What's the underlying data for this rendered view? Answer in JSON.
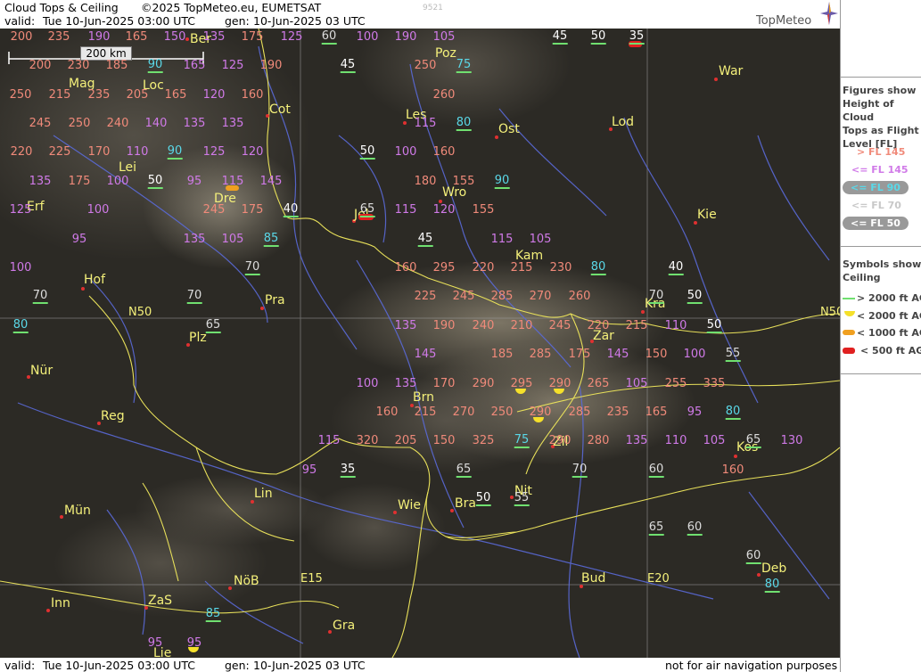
{
  "header": {
    "product": "Cloud Tops & Ceiling",
    "copyright": "©2025 TopMeteo.eu, EUMETSAT",
    "valid_label": "valid:",
    "valid_value": "Tue   10-Jun-2025  03:00 UTC",
    "gen_label": "gen:",
    "gen_value": "10-Jun-2025 03 UTC",
    "run_code": "9521",
    "logo": "TopMeteo"
  },
  "footer": {
    "valid_label": "valid:",
    "valid_value": "Tue   10-Jun-2025  03:00 UTC",
    "gen_label": "gen:",
    "gen_value": "10-Jun-2025 03 UTC",
    "disclaimer": "not for air navigation purposes"
  },
  "scale": {
    "label": "200 km"
  },
  "legend": {
    "heights_title": [
      "Figures show",
      "Height of Cloud",
      "Tops as Flight",
      "Level  [FL]"
    ],
    "height_classes": [
      {
        "label": "> FL 145",
        "color": "#f08a7a"
      },
      {
        "label": "<= FL 145",
        "color": "#d07ae8"
      },
      {
        "label": "<= FL 90",
        "color": "#5ad8e8"
      },
      {
        "label": "<= FL 70",
        "color": "#c8c8c8"
      },
      {
        "label": "<= FL 50",
        "color": "#ffffff"
      }
    ],
    "ceiling_title": [
      "Symbols show",
      "Ceiling"
    ],
    "ceiling_classes": [
      {
        "label": "> 2000 ft AGL",
        "color": "#70e070"
      },
      {
        "label": "< 2000 ft AGL",
        "color": "#f5e02a"
      },
      {
        "label": "< 1000 ft AGL",
        "color": "#f0a020"
      },
      {
        "label": "< 500 ft AGL",
        "color": "#e02020"
      }
    ]
  },
  "grid_labels": [
    "N50",
    "N50",
    "E15",
    "E20"
  ],
  "cities": [
    "Ber",
    "Poz",
    "War",
    "Mag",
    "Loc",
    "Les",
    "Cot",
    "Lod",
    "Ost",
    "Lei",
    "Dre",
    "Wro",
    "Erf",
    "Jel",
    "Kie",
    "Kam",
    "Hof",
    "Pra",
    "Kra",
    "Plz",
    "Zar",
    "Nür",
    "Brn",
    "Zil",
    "Reg",
    "Kos",
    "Lin",
    "Nit",
    "Mün",
    "Wie",
    "Bra",
    "Deb",
    "NöB",
    "Bud",
    "Inn",
    "ZaS",
    "Gra",
    "Lie"
  ],
  "flight_levels": [
    {
      "v": "200",
      "c": "ov"
    },
    {
      "v": "235",
      "c": "ov"
    },
    {
      "v": "190",
      "c": "le"
    },
    {
      "v": "165",
      "c": "ov"
    },
    {
      "v": "150",
      "c": "le"
    },
    {
      "v": "135",
      "c": "le"
    },
    {
      "v": "175",
      "c": "ov"
    },
    {
      "v": "125",
      "c": "le"
    },
    {
      "v": "60",
      "c": "c70"
    },
    {
      "v": "100",
      "c": "le"
    },
    {
      "v": "190",
      "c": "le"
    },
    {
      "v": "105",
      "c": "le"
    },
    {
      "v": "45",
      "c": "c50"
    },
    {
      "v": "50",
      "c": "c50"
    },
    {
      "v": "35",
      "c": "c50"
    },
    {
      "v": "200",
      "c": "ov"
    },
    {
      "v": "230",
      "c": "ov"
    },
    {
      "v": "185",
      "c": "ov"
    },
    {
      "v": "90",
      "c": "c90"
    },
    {
      "v": "165",
      "c": "le"
    },
    {
      "v": "125",
      "c": "le"
    },
    {
      "v": "190",
      "c": "ov"
    },
    {
      "v": "45",
      "c": "c50"
    },
    {
      "v": "250",
      "c": "ov"
    },
    {
      "v": "75",
      "c": "c90"
    },
    {
      "v": "250",
      "c": "ov"
    },
    {
      "v": "215",
      "c": "ov"
    },
    {
      "v": "235",
      "c": "ov"
    },
    {
      "v": "205",
      "c": "ov"
    },
    {
      "v": "165",
      "c": "ov"
    },
    {
      "v": "120",
      "c": "le"
    },
    {
      "v": "160",
      "c": "ov"
    },
    {
      "v": "260",
      "c": "ov"
    },
    {
      "v": "245",
      "c": "ov"
    },
    {
      "v": "250",
      "c": "ov"
    },
    {
      "v": "240",
      "c": "ov"
    },
    {
      "v": "140",
      "c": "le"
    },
    {
      "v": "135",
      "c": "le"
    },
    {
      "v": "135",
      "c": "le"
    },
    {
      "v": "115",
      "c": "le"
    },
    {
      "v": "80",
      "c": "c90"
    },
    {
      "v": "220",
      "c": "ov"
    },
    {
      "v": "225",
      "c": "ov"
    },
    {
      "v": "170",
      "c": "ov"
    },
    {
      "v": "110",
      "c": "le"
    },
    {
      "v": "90",
      "c": "c90"
    },
    {
      "v": "125",
      "c": "le"
    },
    {
      "v": "120",
      "c": "le"
    },
    {
      "v": "50",
      "c": "c50"
    },
    {
      "v": "100",
      "c": "le"
    },
    {
      "v": "160",
      "c": "ov"
    },
    {
      "v": "135",
      "c": "le"
    },
    {
      "v": "175",
      "c": "ov"
    },
    {
      "v": "100",
      "c": "le"
    },
    {
      "v": "50",
      "c": "c50"
    },
    {
      "v": "95",
      "c": "le"
    },
    {
      "v": "115",
      "c": "le"
    },
    {
      "v": "145",
      "c": "le"
    },
    {
      "v": "180",
      "c": "ov"
    },
    {
      "v": "155",
      "c": "ov"
    },
    {
      "v": "90",
      "c": "c90"
    },
    {
      "v": "125",
      "c": "le"
    },
    {
      "v": "100",
      "c": "le"
    },
    {
      "v": "245",
      "c": "ov"
    },
    {
      "v": "175",
      "c": "ov"
    },
    {
      "v": "40",
      "c": "c50"
    },
    {
      "v": "65",
      "c": "c70"
    },
    {
      "v": "115",
      "c": "le"
    },
    {
      "v": "120",
      "c": "le"
    },
    {
      "v": "155",
      "c": "ov"
    },
    {
      "v": "95",
      "c": "le"
    },
    {
      "v": "135",
      "c": "le"
    },
    {
      "v": "105",
      "c": "le"
    },
    {
      "v": "85",
      "c": "c90"
    },
    {
      "v": "45",
      "c": "c50"
    },
    {
      "v": "115",
      "c": "le"
    },
    {
      "v": "105",
      "c": "le"
    },
    {
      "v": "100",
      "c": "le"
    },
    {
      "v": "70",
      "c": "c70"
    },
    {
      "v": "160",
      "c": "ov"
    },
    {
      "v": "295",
      "c": "ov"
    },
    {
      "v": "220",
      "c": "ov"
    },
    {
      "v": "215",
      "c": "ov"
    },
    {
      "v": "230",
      "c": "ov"
    },
    {
      "v": "80",
      "c": "c90"
    },
    {
      "v": "40",
      "c": "c50"
    },
    {
      "v": "70",
      "c": "c70"
    },
    {
      "v": "70",
      "c": "c70"
    },
    {
      "v": "225",
      "c": "ov"
    },
    {
      "v": "245",
      "c": "ov"
    },
    {
      "v": "285",
      "c": "ov"
    },
    {
      "v": "270",
      "c": "ov"
    },
    {
      "v": "260",
      "c": "ov"
    },
    {
      "v": "70",
      "c": "c70"
    },
    {
      "v": "50",
      "c": "c50"
    },
    {
      "v": "80",
      "c": "c90"
    },
    {
      "v": "65",
      "c": "c70"
    },
    {
      "v": "135",
      "c": "le"
    },
    {
      "v": "190",
      "c": "ov"
    },
    {
      "v": "240",
      "c": "ov"
    },
    {
      "v": "210",
      "c": "ov"
    },
    {
      "v": "245",
      "c": "ov"
    },
    {
      "v": "220",
      "c": "ov"
    },
    {
      "v": "215",
      "c": "ov"
    },
    {
      "v": "110",
      "c": "le"
    },
    {
      "v": "50",
      "c": "c50"
    },
    {
      "v": "145",
      "c": "le"
    },
    {
      "v": "185",
      "c": "ov"
    },
    {
      "v": "285",
      "c": "ov"
    },
    {
      "v": "175",
      "c": "ov"
    },
    {
      "v": "145",
      "c": "le"
    },
    {
      "v": "150",
      "c": "ov"
    },
    {
      "v": "100",
      "c": "le"
    },
    {
      "v": "55",
      "c": "c70"
    },
    {
      "v": "100",
      "c": "le"
    },
    {
      "v": "135",
      "c": "le"
    },
    {
      "v": "170",
      "c": "ov"
    },
    {
      "v": "290",
      "c": "ov"
    },
    {
      "v": "295",
      "c": "ov"
    },
    {
      "v": "290",
      "c": "ov"
    },
    {
      "v": "265",
      "c": "ov"
    },
    {
      "v": "105",
      "c": "le"
    },
    {
      "v": "255",
      "c": "ov"
    },
    {
      "v": "335",
      "c": "ov"
    },
    {
      "v": "160",
      "c": "ov"
    },
    {
      "v": "215",
      "c": "ov"
    },
    {
      "v": "270",
      "c": "ov"
    },
    {
      "v": "250",
      "c": "ov"
    },
    {
      "v": "290",
      "c": "ov"
    },
    {
      "v": "285",
      "c": "ov"
    },
    {
      "v": "235",
      "c": "ov"
    },
    {
      "v": "165",
      "c": "ov"
    },
    {
      "v": "95",
      "c": "le"
    },
    {
      "v": "80",
      "c": "c90"
    },
    {
      "v": "115",
      "c": "le"
    },
    {
      "v": "320",
      "c": "ov"
    },
    {
      "v": "205",
      "c": "ov"
    },
    {
      "v": "150",
      "c": "ov"
    },
    {
      "v": "325",
      "c": "ov"
    },
    {
      "v": "75",
      "c": "c90"
    },
    {
      "v": "290",
      "c": "ov"
    },
    {
      "v": "280",
      "c": "ov"
    },
    {
      "v": "135",
      "c": "le"
    },
    {
      "v": "110",
      "c": "le"
    },
    {
      "v": "105",
      "c": "le"
    },
    {
      "v": "65",
      "c": "c70"
    },
    {
      "v": "130",
      "c": "le"
    },
    {
      "v": "95",
      "c": "le"
    },
    {
      "v": "35",
      "c": "c50"
    },
    {
      "v": "65",
      "c": "c70"
    },
    {
      "v": "70",
      "c": "c70"
    },
    {
      "v": "60",
      "c": "c70"
    },
    {
      "v": "160",
      "c": "ov"
    },
    {
      "v": "50",
      "c": "c50"
    },
    {
      "v": "55",
      "c": "c70"
    },
    {
      "v": "65",
      "c": "c70"
    },
    {
      "v": "60",
      "c": "c70"
    },
    {
      "v": "60",
      "c": "c70"
    },
    {
      "v": "80",
      "c": "c90"
    },
    {
      "v": "85",
      "c": "c90"
    },
    {
      "v": "95",
      "c": "le"
    },
    {
      "v": "95",
      "c": "le"
    }
  ]
}
